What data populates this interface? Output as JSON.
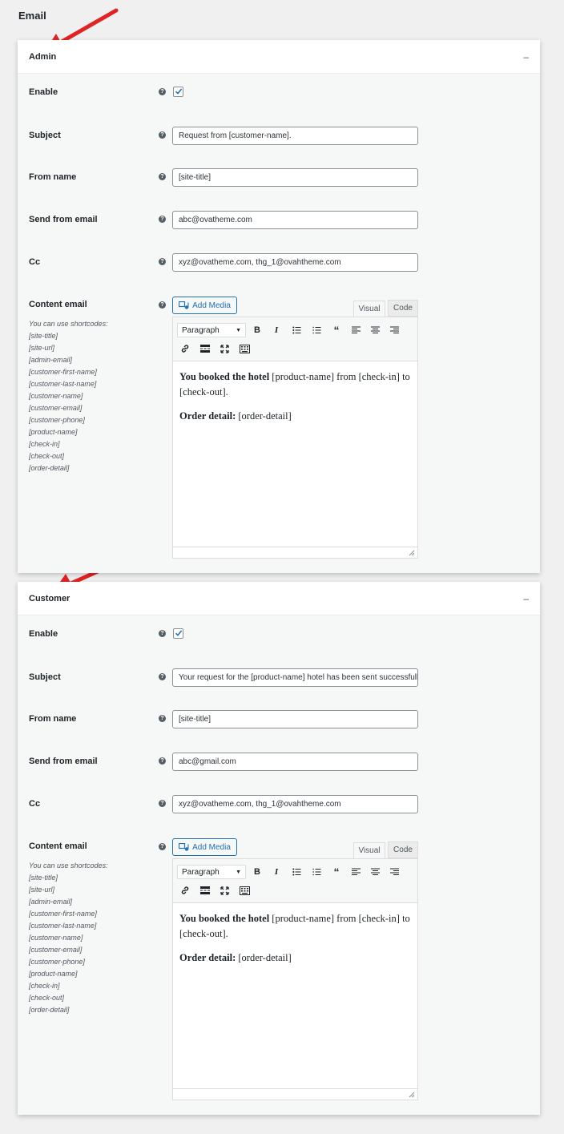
{
  "page_title": "Email",
  "sections": [
    {
      "title": "Admin",
      "collapse_symbol": "–",
      "fields": {
        "enable_label": "Enable",
        "subject_label": "Subject",
        "subject_value": "Request from [customer-name].",
        "from_name_label": "From name",
        "from_name_value": "[site-title]",
        "send_from_email_label": "Send from email",
        "send_from_email_value": "abc@ovatheme.com",
        "cc_label": "Cc",
        "cc_value": "xyz@ovatheme.com, thg_1@ovahtheme.com",
        "content_email_label": "Content email",
        "shortcodes_intro": "You can use shortcodes:",
        "shortcodes": [
          "[site-title]",
          "[site-url]",
          "[admin-email]",
          "[customer-first-name]",
          "[customer-last-name]",
          "[customer-name]",
          "[customer-email]",
          "[customer-phone]",
          "[product-name]",
          "[check-in]",
          "[check-out]",
          "[order-detail]"
        ]
      },
      "editor": {
        "add_media_label": "Add Media",
        "tab_visual": "Visual",
        "tab_code": "Code",
        "format_value": "Paragraph",
        "content_line1_bold": "You booked the hotel",
        "content_line1_rest": " [product-name] from [check-in] to [check-out].",
        "content_line2_bold": "Order detail:",
        "content_line2_rest": " [order-detail]"
      }
    },
    {
      "title": "Customer",
      "collapse_symbol": "–",
      "fields": {
        "enable_label": "Enable",
        "subject_label": "Subject",
        "subject_value": "Your request for the [product-name] hotel has been sent successfully",
        "from_name_label": "From name",
        "from_name_value": "[site-title]",
        "send_from_email_label": "Send from email",
        "send_from_email_value": "abc@gmail.com",
        "cc_label": "Cc",
        "cc_value": "xyz@ovatheme.com, thg_1@ovahtheme.com",
        "content_email_label": "Content email",
        "shortcodes_intro": "You can use shortcodes:",
        "shortcodes": [
          "[site-title]",
          "[site-url]",
          "[admin-email]",
          "[customer-first-name]",
          "[customer-last-name]",
          "[customer-name]",
          "[customer-email]",
          "[customer-phone]",
          "[product-name]",
          "[check-in]",
          "[check-out]",
          "[order-detail]"
        ]
      },
      "editor": {
        "add_media_label": "Add Media",
        "tab_visual": "Visual",
        "tab_code": "Code",
        "format_value": "Paragraph",
        "content_line1_bold": "You booked the hotel",
        "content_line1_rest": " [product-name] from [check-in] to [check-out].",
        "content_line2_bold": "Order detail:",
        "content_line2_rest": " [order-detail]"
      }
    }
  ],
  "colors": {
    "background": "#f0f0f1",
    "accent": "#2271b1",
    "annotation_arrow": "#e02424"
  }
}
